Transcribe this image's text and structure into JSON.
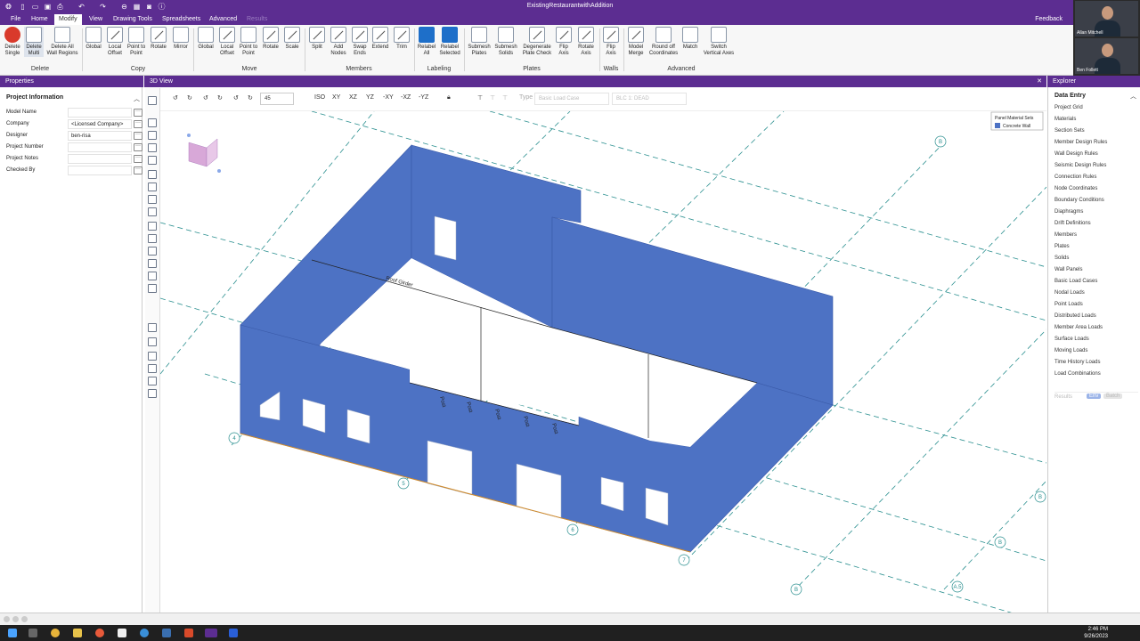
{
  "window": {
    "title": "ExistingRestaurantwithAddition"
  },
  "menus": [
    {
      "label": "File"
    },
    {
      "label": "Home"
    },
    {
      "label": "Modify"
    },
    {
      "label": "View"
    },
    {
      "label": "Drawing Tools"
    },
    {
      "label": "Spreadsheets"
    },
    {
      "label": "Advanced"
    },
    {
      "label": "Results"
    }
  ],
  "feedback": "Feedback",
  "ribbon": {
    "delete_single": "Delete\nSingle",
    "delete_multi": "Delete\nMulti",
    "delete_all": "Delete All\nWall Regions",
    "copy_global": "Global",
    "copy_local": "Local\nOffset",
    "copy_p2p": "Point to\nPoint",
    "copy_rotate": "Rotate",
    "copy_mirror": "Mirror",
    "move_global": "Global",
    "move_local": "Local\nOffset",
    "move_p2p": "Point to\nPoint",
    "move_rotate": "Rotate",
    "move_scale": "Scale",
    "split": "Split",
    "add_nodes": "Add\nNodes",
    "swap_ends": "Swap\nEnds",
    "extend": "Extend",
    "trim": "Trim",
    "relabel_all": "Relabel\nAll",
    "relabel_selected": "Relabel\nSelected",
    "submesh_plates": "Submesh\nPlates",
    "submesh_solids": "Submesh\nSolids",
    "degenerate": "Degenerate\nPlate Check",
    "flip_axis": "Flip\nAxis",
    "rotate_axis": "Rotate\nAxis",
    "walls_flip": "Flip\nAxis",
    "model_merge": "Model\nMerge",
    "round_off": "Round off\nCoordinates",
    "match": "Match",
    "switch_axes": "Switch\nVertical Axes",
    "groups": {
      "delete": "Delete",
      "copy": "Copy",
      "move": "Move",
      "members": "Members",
      "labeling": "Labeling",
      "plates": "Plates",
      "walls": "Walls",
      "advanced": "Advanced"
    }
  },
  "video": {
    "p1": "Allan Mitchell",
    "p2": "Ben Follett"
  },
  "properties": {
    "title": "Properties",
    "section": "Project Information",
    "rows": [
      {
        "label": "Model Name",
        "value": ""
      },
      {
        "label": "Company",
        "value": "<Licensed Company>"
      },
      {
        "label": "Designer",
        "value": "ben-risa"
      },
      {
        "label": "Project Number",
        "value": ""
      },
      {
        "label": "Project Notes",
        "value": ""
      },
      {
        "label": "Checked By",
        "value": ""
      }
    ]
  },
  "view": {
    "title": "3D View",
    "angle": "45",
    "iso": "ISO",
    "xy": "XY",
    "xz": "XZ",
    "yz": "YZ",
    "nxy": "-XY",
    "nxz": "-XZ",
    "nyz": "-YZ",
    "type": "Type",
    "loadtype": "Basic Load Case",
    "loadcase": "BLC 1: DEAD",
    "legend_title": "Panel Material Sets",
    "legend_item": "Concrete Wall",
    "labels": {
      "roof_girder": "Roof Girder",
      "post": "Post",
      "b1": "B",
      "b2": "B",
      "b3": "B",
      "a5": "A.5",
      "n4": "4",
      "n5": "5",
      "n6": "6",
      "n7": "7",
      "b_top": "B"
    },
    "colors": {
      "wall": "#4d72c4",
      "grid": "#2a8f8f",
      "accent": "#5c2d91"
    }
  },
  "explorer": {
    "title": "Explorer",
    "section": "Data Entry",
    "items": [
      "Project Grid",
      "Materials",
      "Section Sets",
      "Member Design Rules",
      "Wall Design Rules",
      "Seismic Design Rules",
      "Connection Rules",
      "Node Coordinates",
      "Boundary Conditions",
      "Diaphragms",
      "Drift Definitions",
      "Members",
      "Plates",
      "Solids",
      "Wall Panels",
      "Basic Load Cases",
      "Nodal Loads",
      "Point Loads",
      "Distributed Loads",
      "Member Area Loads",
      "Surface Loads",
      "Moving Loads",
      "Time History Loads",
      "Load Combinations"
    ],
    "results": "Results",
    "env": "Env",
    "batch": "Batch"
  },
  "clock": {
    "time": "2:46 PM",
    "date": "9/26/2023"
  }
}
